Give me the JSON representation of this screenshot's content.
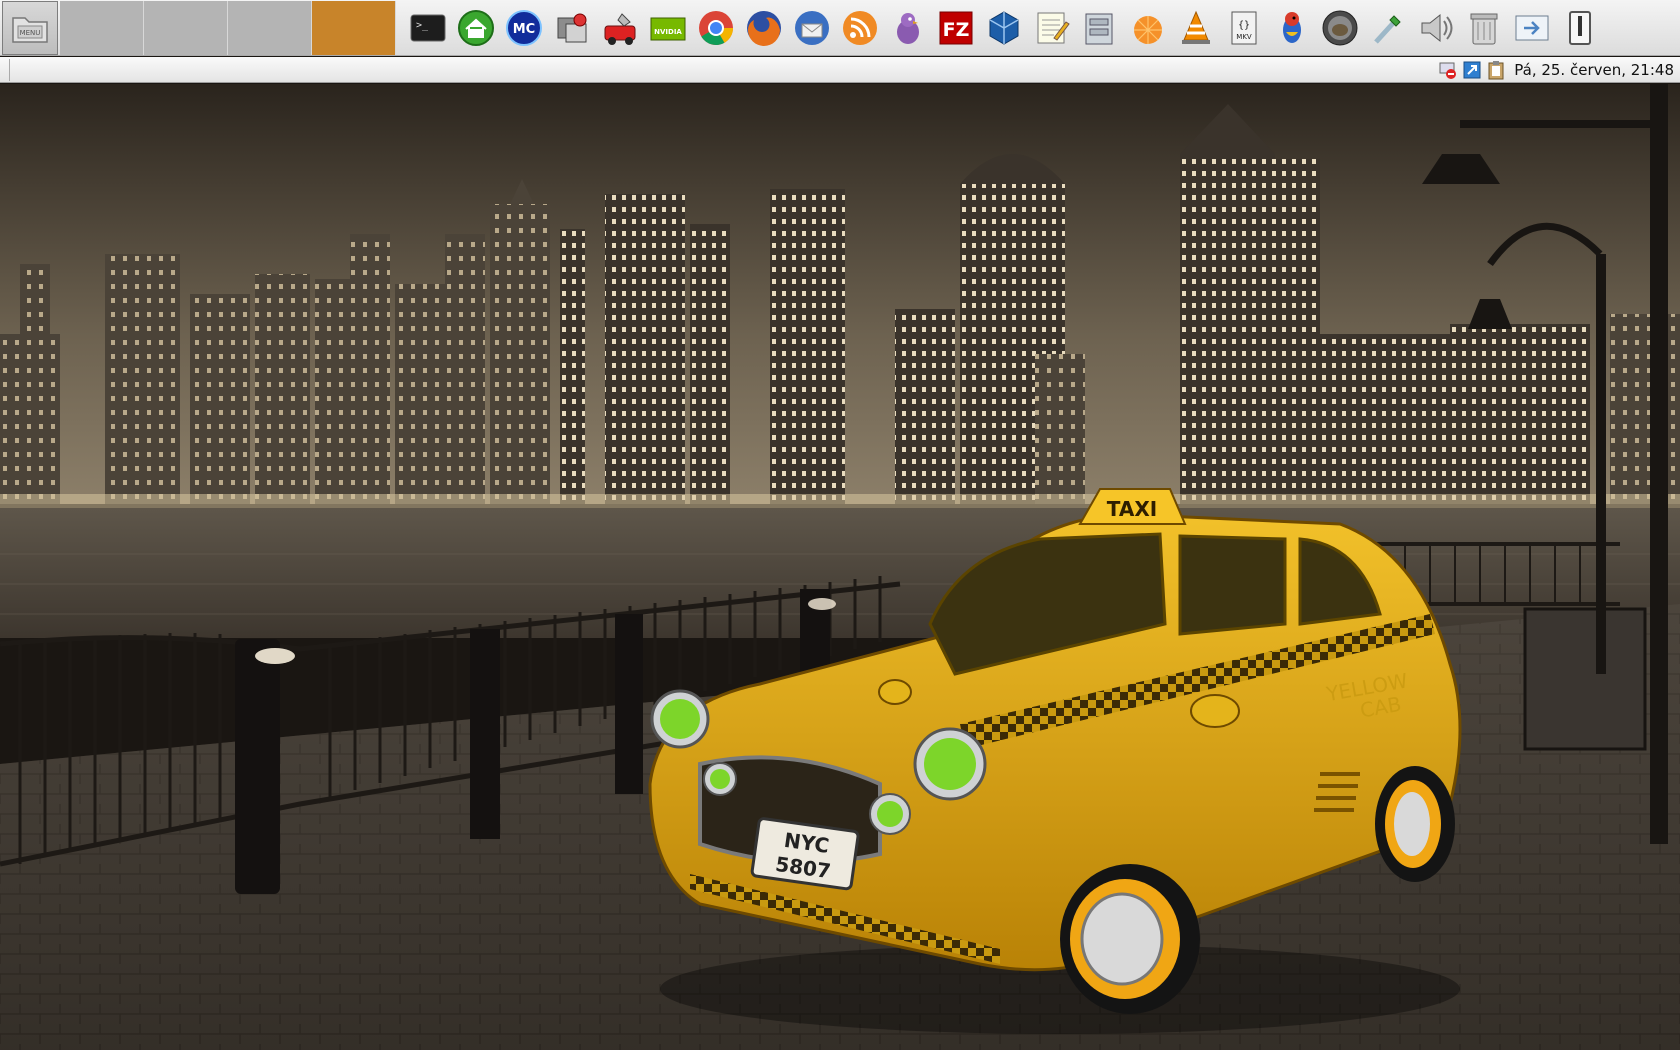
{
  "panel": {
    "menu_icon": "folder-icon",
    "workspaces": [
      {
        "name": "workspace-1",
        "color": "#b4b4b4",
        "active": false
      },
      {
        "name": "workspace-2",
        "color": "#b4b4b4",
        "active": false
      },
      {
        "name": "workspace-3",
        "color": "#b4b4b4",
        "active": false
      },
      {
        "name": "workspace-4",
        "color": "#c8842a",
        "active": true
      }
    ],
    "launchers": [
      {
        "icon": "terminal-icon"
      },
      {
        "icon": "home-icon"
      },
      {
        "icon": "midnight-commander-icon"
      },
      {
        "icon": "package-manager-icon"
      },
      {
        "icon": "system-tool-icon"
      },
      {
        "icon": "nvidia-settings-icon"
      },
      {
        "icon": "chrome-icon"
      },
      {
        "icon": "firefox-icon"
      },
      {
        "icon": "thunderbird-icon"
      },
      {
        "icon": "rss-reader-icon"
      },
      {
        "icon": "pidgin-icon"
      },
      {
        "icon": "filezilla-icon"
      },
      {
        "icon": "virtualbox-icon"
      },
      {
        "icon": "text-editor-icon"
      },
      {
        "icon": "file-cabinet-icon"
      },
      {
        "icon": "orange-icon"
      },
      {
        "icon": "vlc-icon"
      },
      {
        "icon": "mkv-tool-icon"
      },
      {
        "icon": "bird-app-icon"
      },
      {
        "icon": "gimp-icon"
      },
      {
        "icon": "color-picker-icon"
      },
      {
        "icon": "volume-icon"
      },
      {
        "icon": "trash-icon"
      },
      {
        "icon": "window-switch-icon"
      },
      {
        "icon": "show-desktop-icon"
      }
    ],
    "labels": {
      "menu": "MENU",
      "terminal": ">_",
      "mc": "MC",
      "nvidia": "NVIDIA",
      "filezilla": "FZ",
      "mkv": "MKV",
      "mkv_brace": "{}"
    }
  },
  "secondbar": {
    "tray": [
      {
        "icon": "network-disconnected-icon"
      },
      {
        "icon": "update-notifier-icon"
      },
      {
        "icon": "clipboard-icon"
      }
    ],
    "clock": "Pá, 25. červen, 21:48"
  },
  "wallpaper": {
    "taxi_roof_sign": "TAXI",
    "plate_line1": "NYC",
    "plate_line2": "5807",
    "door_text_1": "YELLOW",
    "door_text_2": "CAB"
  }
}
